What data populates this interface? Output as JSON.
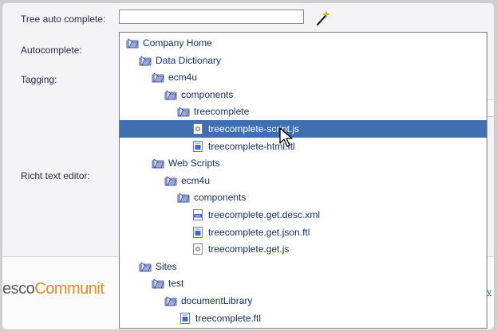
{
  "form": {
    "tree_label": "Tree auto complete:",
    "autocomplete_label": "Autocomplete:",
    "tagging_label": "Tagging:",
    "rte_label": "Richt text editor:",
    "tree_input_value": ""
  },
  "footer": {
    "brand_part1": "esco",
    "brand_part2": "Communit",
    "link_text": "ty"
  },
  "colors": {
    "selection": "#3f6eb1",
    "link": "#172f6b",
    "brand_orange": "#e08a1f"
  },
  "tree": [
    {
      "label": "Company Home",
      "type": "folder",
      "selected": false
    },
    {
      "label": "Data Dictionary",
      "type": "folder",
      "selected": false
    },
    {
      "label": "ecm4u",
      "type": "folder",
      "selected": false
    },
    {
      "label": "components",
      "type": "folder",
      "selected": false
    },
    {
      "label": "treecomplete",
      "type": "folder",
      "selected": false
    },
    {
      "label": "treecomplete-script.js",
      "type": "script-file",
      "selected": true
    },
    {
      "label": "treecomplete-html.ftl",
      "type": "template-file",
      "selected": false
    },
    {
      "label": "Web Scripts",
      "type": "folder",
      "selected": false
    },
    {
      "label": "ecm4u",
      "type": "folder",
      "selected": false
    },
    {
      "label": "components",
      "type": "folder",
      "selected": false
    },
    {
      "label": "treecomplete.get.desc.xml",
      "type": "xml-file",
      "selected": false
    },
    {
      "label": "treecomplete.get.json.ftl",
      "type": "template-file",
      "selected": false
    },
    {
      "label": "treecomplete.get.js",
      "type": "script-file",
      "selected": false
    },
    {
      "label": "Sites",
      "type": "folder",
      "selected": false
    },
    {
      "label": "test",
      "type": "folder",
      "selected": false
    },
    {
      "label": "documentLibrary",
      "type": "folder",
      "selected": false
    },
    {
      "label": "treecomplete.ftl",
      "type": "template-file",
      "selected": false
    }
  ]
}
